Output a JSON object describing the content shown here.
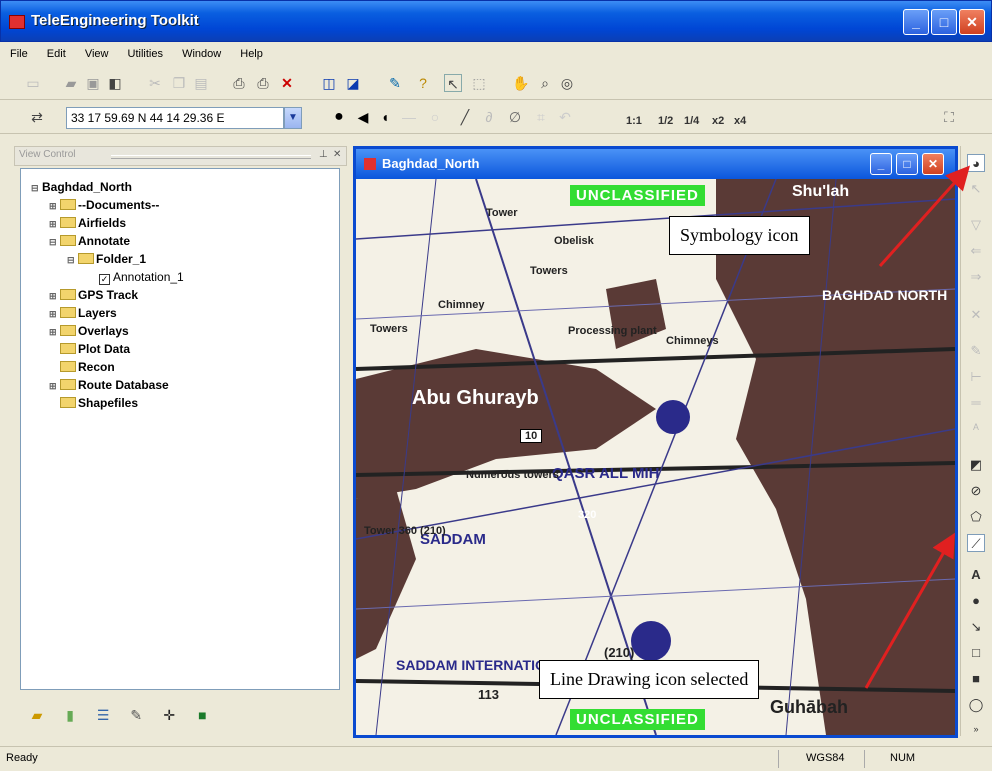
{
  "app": {
    "title": "TeleEngineering Toolkit",
    "accent": "#0046d5"
  },
  "menu": [
    "File",
    "Edit",
    "View",
    "Utilities",
    "Window",
    "Help"
  ],
  "coord": {
    "value": "33 17 59.69 N  44 14 29.36 E"
  },
  "zoom": {
    "z1": "1:1",
    "z2": "1/2",
    "z3": "1/4",
    "z4": "x2",
    "z5": "x4"
  },
  "panel": {
    "header": "View Control"
  },
  "tree": {
    "root": "Baghdad_North",
    "items": [
      "--Documents--",
      "Airfields",
      "Annotate",
      "Folder_1",
      "Annotation_1",
      "GPS Track",
      "Layers",
      "Overlays",
      "Plot Data",
      "Recon",
      "Route Database",
      "Shapefiles"
    ]
  },
  "mapwindow": {
    "title": "Baghdad_North"
  },
  "map": {
    "classification_top": "UNCLASSIFIED",
    "classification_bottom": "UNCLASSIFIED",
    "labels": [
      "Tower",
      "Obelisk",
      "Towers",
      "Chimney",
      "Towers",
      "Processing plant",
      "Chimneys",
      "Abu Ghurayb",
      "QASR ALL MIH",
      "SADDAM",
      "Numerous towers",
      "Tower 360 (210)",
      "320",
      "(210)",
      "SADDAM INTERNATIONAL",
      "Guhābah",
      "BAGHDAD NORTH",
      "10",
      "113",
      "Shu'lah"
    ]
  },
  "callouts": {
    "symbology": "Symbology icon",
    "line": "Line Drawing icon selected"
  },
  "status": {
    "left": "Ready",
    "datum": "WGS84",
    "num": "NUM"
  }
}
